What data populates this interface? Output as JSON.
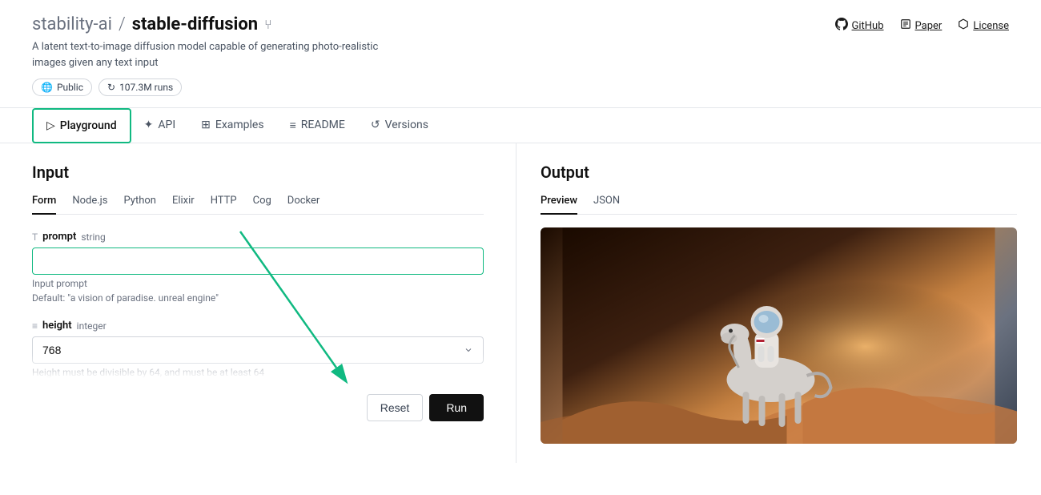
{
  "header": {
    "org": "stability-ai",
    "separator": "/",
    "repo": "stable-diffusion",
    "description_line1": "A latent text-to-image diffusion model capable of generating photo-realistic",
    "description_line2": "images given any text input",
    "fork_icon": "⑂",
    "badges": [
      {
        "icon": "🌐",
        "label": "Public"
      },
      {
        "icon": "↻",
        "label": "107.3M runs"
      }
    ],
    "links": [
      {
        "icon": "github",
        "label": "GitHub"
      },
      {
        "icon": "paper",
        "label": "Paper"
      },
      {
        "icon": "scale",
        "label": "License"
      }
    ]
  },
  "tabs": [
    {
      "id": "playground",
      "label": "Playground",
      "icon": "▷",
      "active": true
    },
    {
      "id": "api",
      "label": "API",
      "icon": "✦"
    },
    {
      "id": "examples",
      "label": "Examples",
      "icon": "⊞"
    },
    {
      "id": "readme",
      "label": "README",
      "icon": "≡"
    },
    {
      "id": "versions",
      "label": "Versions",
      "icon": "↺"
    }
  ],
  "input": {
    "title": "Input",
    "sub_tabs": [
      {
        "id": "form",
        "label": "Form",
        "active": true
      },
      {
        "id": "nodejs",
        "label": "Node.js"
      },
      {
        "id": "python",
        "label": "Python"
      },
      {
        "id": "elixir",
        "label": "Elixir"
      },
      {
        "id": "http",
        "label": "HTTP"
      },
      {
        "id": "cog",
        "label": "Cog"
      },
      {
        "id": "docker",
        "label": "Docker"
      }
    ],
    "fields": [
      {
        "id": "prompt",
        "icon": "T",
        "name": "prompt",
        "type": "string",
        "placeholder": "",
        "hint1": "Input prompt",
        "hint2": "Default: \"a vision of paradise. unreal engine\""
      },
      {
        "id": "height",
        "icon": "≡",
        "name": "height",
        "type": "integer",
        "value": "768",
        "hint": "Height must be divisible by..."
      }
    ],
    "buttons": {
      "reset": "Reset",
      "run": "Run"
    }
  },
  "output": {
    "title": "Output",
    "sub_tabs": [
      {
        "id": "preview",
        "label": "Preview",
        "active": true
      },
      {
        "id": "json",
        "label": "JSON"
      }
    ]
  }
}
